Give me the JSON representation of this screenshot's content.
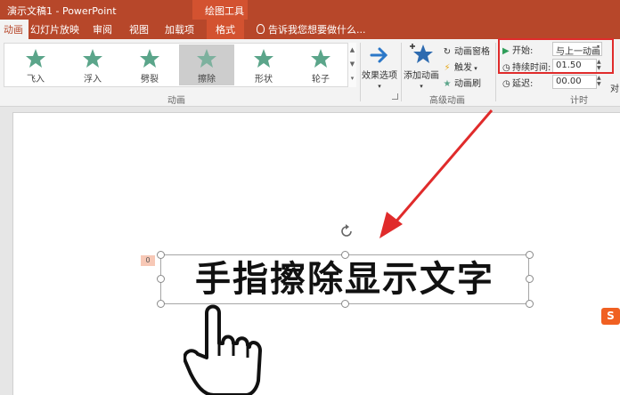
{
  "window": {
    "title": "演示文稿1 - PowerPoint",
    "tools_context_title": "绘图工具"
  },
  "tabs": [
    {
      "label": "动画"
    },
    {
      "label": "幻灯片放映"
    },
    {
      "label": "审阅"
    },
    {
      "label": "视图"
    },
    {
      "label": "加载项"
    },
    {
      "label": "格式"
    }
  ],
  "tell_me": {
    "label": "告诉我您想要做什么..."
  },
  "ribbon": {
    "animation_gallery": {
      "items": [
        {
          "label": "飞入",
          "icon": "star-fly-in-icon"
        },
        {
          "label": "浮入",
          "icon": "star-float-in-icon"
        },
        {
          "label": "劈裂",
          "icon": "star-split-icon"
        },
        {
          "label": "擦除",
          "icon": "star-wipe-icon",
          "selected": true
        },
        {
          "label": "形状",
          "icon": "star-shape-icon"
        },
        {
          "label": "轮子",
          "icon": "star-wheel-icon"
        }
      ],
      "group_label": "动画"
    },
    "effect_options": {
      "label": "效果选项"
    },
    "advanced": {
      "add_animation": "添加动画",
      "animation_pane": "动画窗格",
      "trigger": "触发",
      "animation_painter": "动画刷",
      "group_label": "高级动画"
    },
    "timing": {
      "start_label": "开始:",
      "start_value": "与上一动画...",
      "duration_label": "持续时间:",
      "duration_value": "01.50",
      "delay_label": "延迟:",
      "delay_value": "00.00",
      "group_label": "计时",
      "cut_off_label": "对"
    }
  },
  "slide": {
    "text": "手指擦除显示文字",
    "animation_tag": "0"
  },
  "ime": {
    "label": "S"
  },
  "colors": {
    "accent": "#b7472a",
    "highlight": "#e02b2b",
    "star": "#5ba58a"
  }
}
